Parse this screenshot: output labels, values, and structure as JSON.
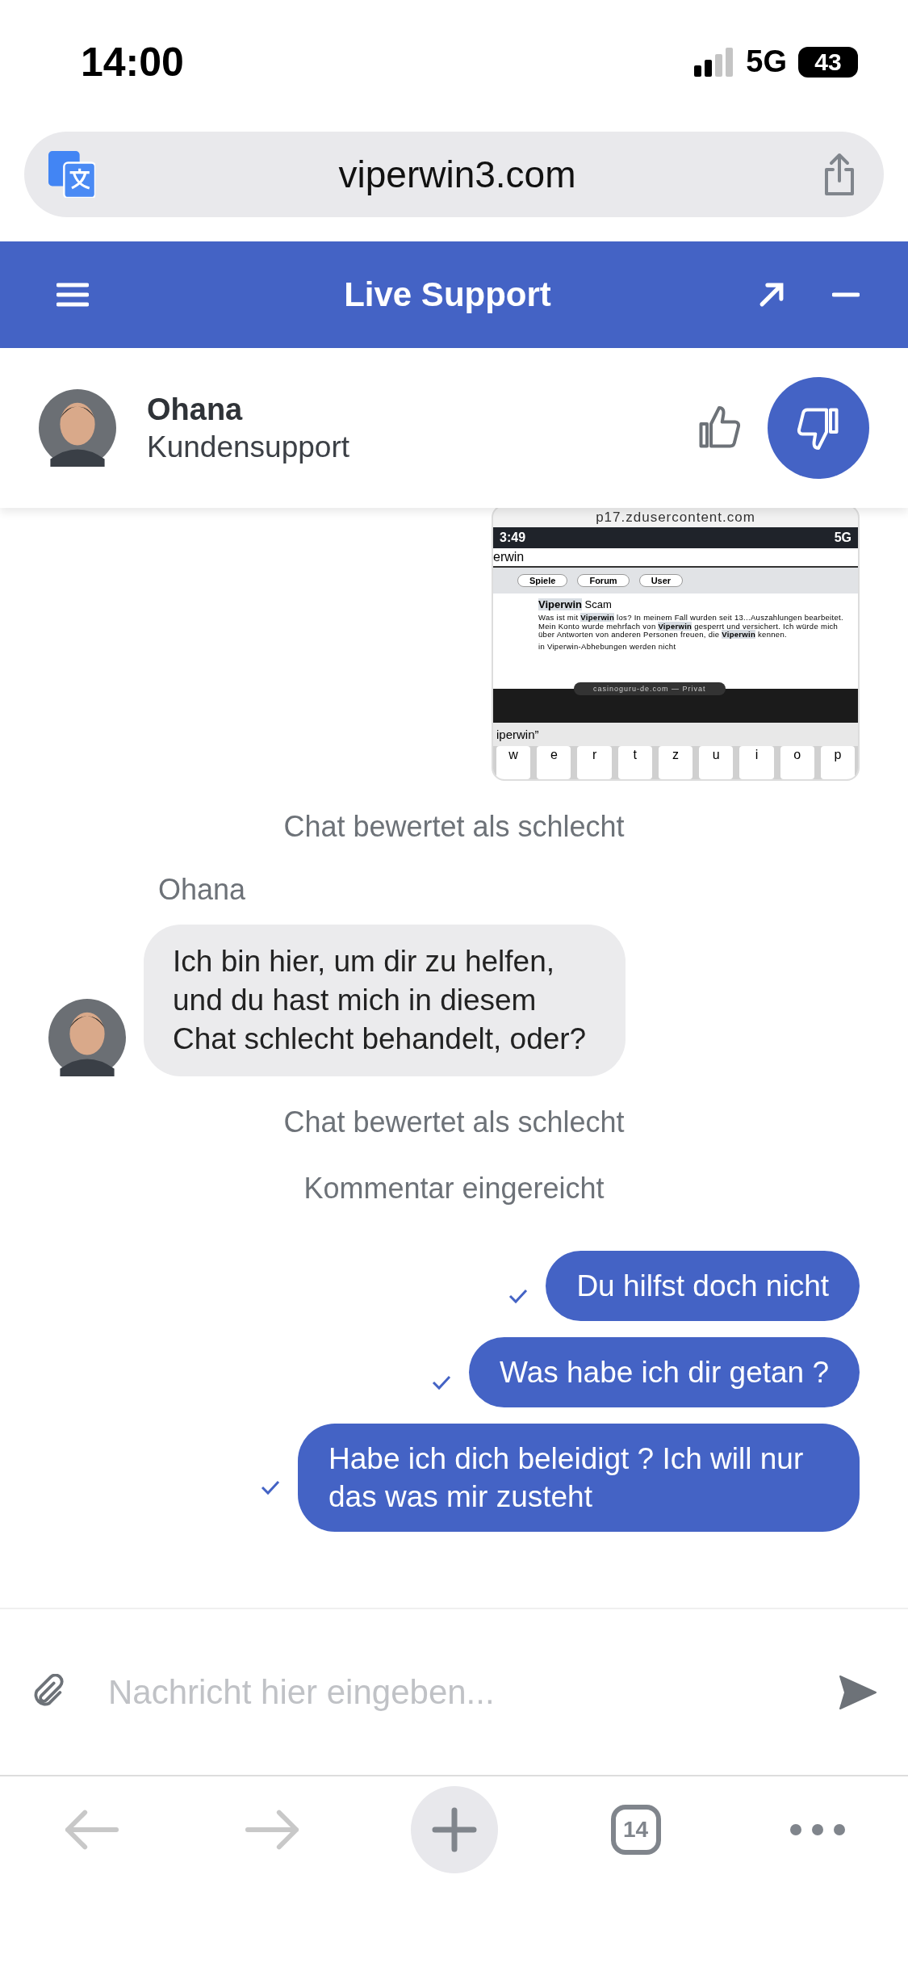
{
  "status_bar": {
    "time": "14:00",
    "network": "5G",
    "battery": "43"
  },
  "browser": {
    "url": "viperwin3.com"
  },
  "header": {
    "title": "Live Support"
  },
  "agent": {
    "name": "Ohana",
    "role": "Kundensupport"
  },
  "rating": [
    {
      "kind": "up",
      "selected": false
    },
    {
      "kind": "down",
      "selected": true
    }
  ],
  "messages": [
    {
      "kind": "image",
      "source": "p17.zdusercontent.com",
      "shot": {
        "time": "3:49",
        "network": "5G",
        "page": "erwin",
        "chips": [
          "Spiele",
          "Forum",
          "User"
        ],
        "title_highlight": "Viperwin",
        "title_rest": "Scam",
        "paragraph": "Was ist mit **Viperwin** los? In meinem Fall wurden seit 13...Auszahlungen bearbeitet. Mein Konto wurde mehrfach von **Viperwin** gesperrt und versichert. Ich würde mich über Antworten von anderen Personen freuen, die **Viperwin** kennen.",
        "paragraph_2": "in Viperwin-Abhebungen werden nicht",
        "toast": "casinoguru-de.com — Privat",
        "query": "iperwin”",
        "keys": [
          "w",
          "e",
          "r",
          "t",
          "z",
          "u",
          "i",
          "o",
          "p"
        ]
      }
    },
    {
      "kind": "system",
      "text": "Chat bewertet als schlecht"
    },
    {
      "kind": "agent",
      "sender": "Ohana",
      "text": "Ich bin hier, um dir zu helfen, und du hast mich in diesem Chat schlecht behandelt, oder?"
    },
    {
      "kind": "system",
      "text": "Chat bewertet als schlecht"
    },
    {
      "kind": "system",
      "text": "Kommentar eingereicht"
    },
    {
      "kind": "user",
      "text": "Du hilfst doch nicht",
      "delivered": true
    },
    {
      "kind": "user",
      "text": "Was habe ich dir getan ?",
      "delivered": true
    },
    {
      "kind": "user",
      "text": "Habe ich dich beleidigt ? Ich will nur das was mir zusteht",
      "delivered": true
    }
  ],
  "composer": {
    "placeholder": "Nachricht hier eingeben..."
  },
  "toolbar": {
    "tabs_count": "14"
  }
}
